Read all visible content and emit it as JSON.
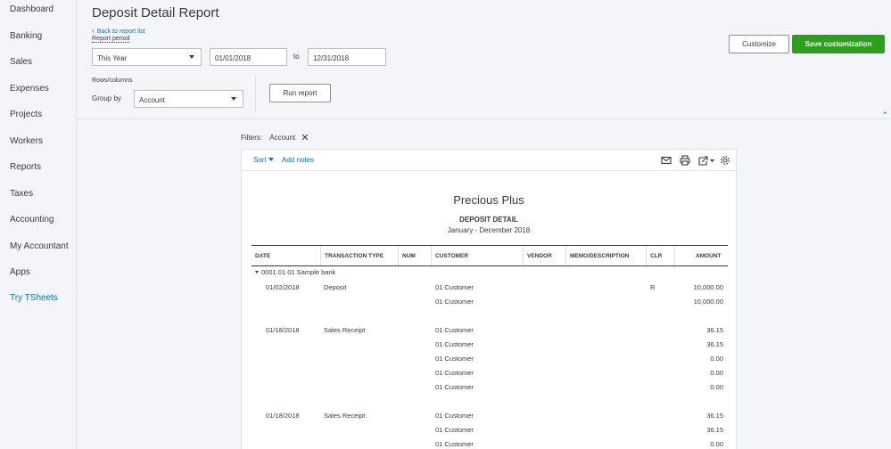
{
  "nav": [
    {
      "label": "Dashboard"
    },
    {
      "label": "Banking"
    },
    {
      "label": "Sales"
    },
    {
      "label": "Expenses"
    },
    {
      "label": "Projects"
    },
    {
      "label": "Workers"
    },
    {
      "label": "Reports"
    },
    {
      "label": "Taxes"
    },
    {
      "label": "Accounting"
    },
    {
      "label": "My Accountant"
    },
    {
      "label": "Apps"
    },
    {
      "label": "Try TSheets"
    }
  ],
  "header": {
    "title": "Deposit Detail Report",
    "back_link": "Back to report list",
    "report_period_label": "Report period",
    "period_select": "This Year",
    "from_date": "01/01/2018",
    "to_label": "to",
    "to_date": "12/31/2018",
    "rows_columns_label": "Rows/columns",
    "group_by_label": "Group by",
    "group_by_value": "Account",
    "run_report": "Run report",
    "customize": "Customize",
    "save_customization": "Save customization"
  },
  "filters": {
    "label": "Filters:",
    "chip": "Account"
  },
  "toolbar": {
    "sort": "Sort",
    "add_notes": "Add notes"
  },
  "report": {
    "company": "Precious Plus",
    "title": "DEPOSIT DETAIL",
    "date_range": "January - December 2018",
    "columns": [
      "DATE",
      "TRANSACTION TYPE",
      "NUM",
      "CUSTOMER",
      "VENDOR",
      "MEMO/DESCRIPTION",
      "CLR",
      "AMOUNT"
    ],
    "group": "0001.01 01 Sample bank",
    "rows": [
      {
        "date": "01/02/2018",
        "type": "Deposit",
        "customer": "01 Customer",
        "clr": "R",
        "amount": "10,000.00"
      },
      {
        "date": "",
        "type": "",
        "customer": "01 Customer",
        "clr": "",
        "amount": "10,000.00"
      },
      {
        "date": "01/18/2018",
        "type": "Sales Receipt",
        "customer": "01 Customer",
        "clr": "",
        "amount": "36.15"
      },
      {
        "date": "",
        "type": "",
        "customer": "01 Customer",
        "clr": "",
        "amount": "36.15"
      },
      {
        "date": "",
        "type": "",
        "customer": "01 Customer",
        "clr": "",
        "amount": "0.00"
      },
      {
        "date": "",
        "type": "",
        "customer": "01 Customer",
        "clr": "",
        "amount": "0.00"
      },
      {
        "date": "",
        "type": "",
        "customer": "01 Customer",
        "clr": "",
        "amount": "0.00"
      },
      {
        "date": "01/18/2018",
        "type": "Sales Receipt",
        "customer": "01 Customer",
        "clr": "",
        "amount": "36.15"
      },
      {
        "date": "",
        "type": "",
        "customer": "01 Customer",
        "clr": "",
        "amount": "36.15"
      },
      {
        "date": "",
        "type": "",
        "customer": "01 Customer",
        "clr": "",
        "amount": "0.00"
      }
    ]
  },
  "icons": {
    "email": "envelope-icon",
    "print": "printer-icon",
    "export": "export-icon",
    "settings": "gear-icon"
  }
}
